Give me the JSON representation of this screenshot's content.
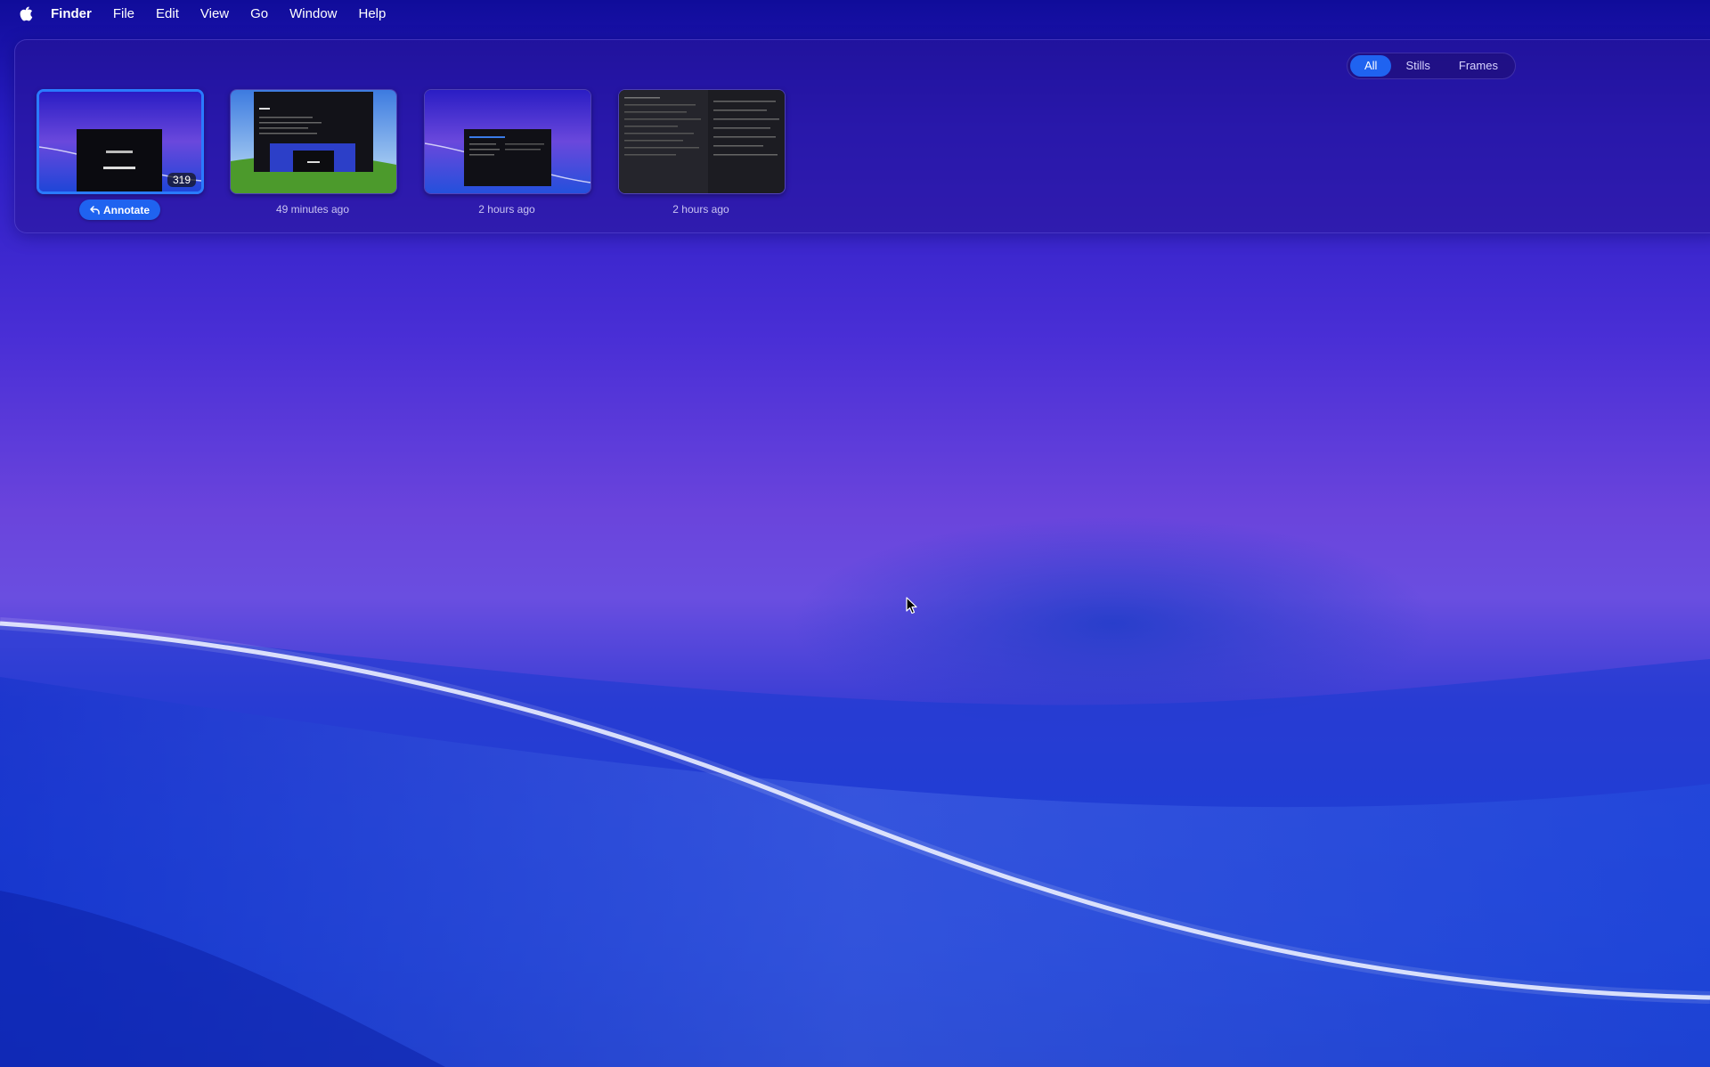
{
  "menubar": {
    "apple_icon": "apple-logo-icon",
    "items": [
      "Finder",
      "File",
      "Edit",
      "View",
      "Go",
      "Window",
      "Help"
    ]
  },
  "shelf": {
    "filter": {
      "options": [
        "All",
        "Stills",
        "Frames"
      ],
      "selected": "All"
    },
    "thumbnails": [
      {
        "caption": "",
        "badge": "319",
        "selected": true
      },
      {
        "caption": "49 minutes ago",
        "badge": "",
        "selected": false
      },
      {
        "caption": "2 hours ago",
        "badge": "",
        "selected": false
      },
      {
        "caption": "2 hours ago",
        "badge": "",
        "selected": false
      }
    ],
    "annotate_button": {
      "label": "Annotate",
      "icon": "reply-arrow-icon"
    }
  },
  "colors": {
    "accent": "#1f63f0",
    "selection_border": "#2a7bff"
  }
}
